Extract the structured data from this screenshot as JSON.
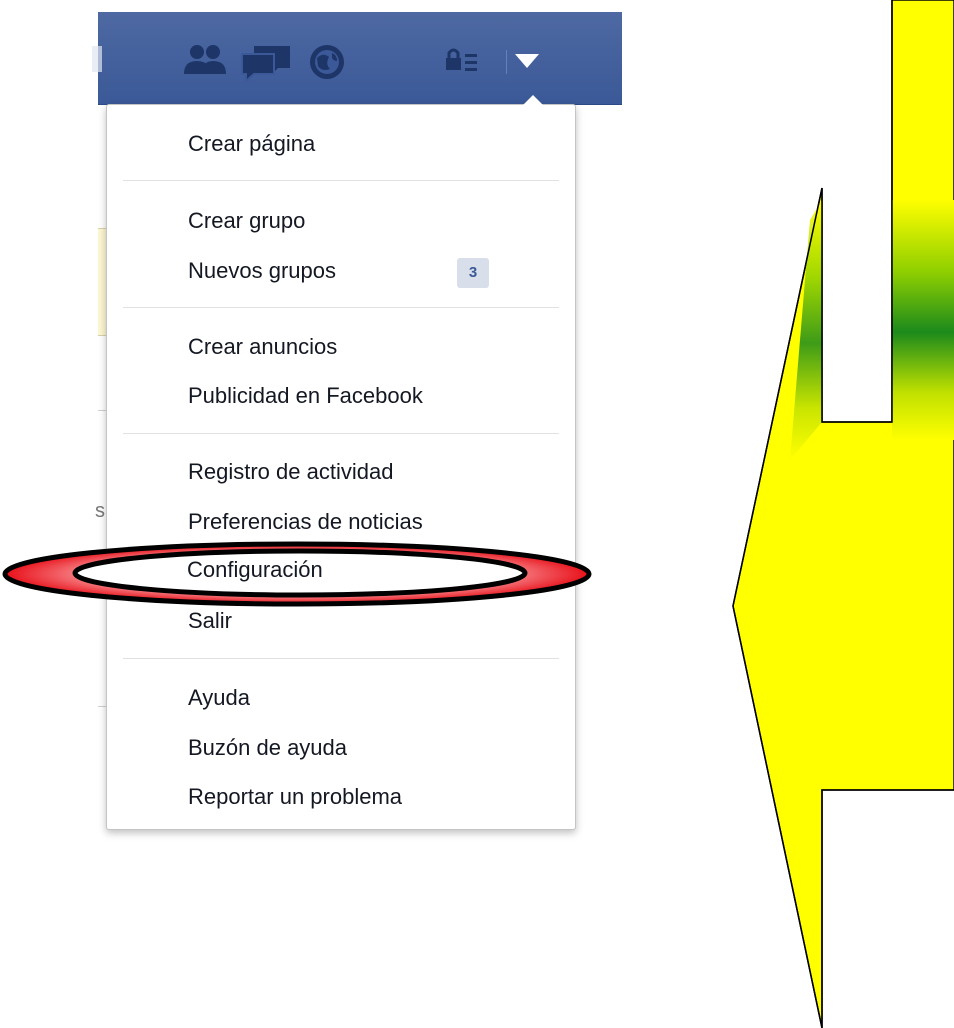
{
  "topbar": {
    "icons": [
      "friends-icon",
      "messages-icon",
      "globe-icon",
      "privacy-icon",
      "account-menu-arrow-icon"
    ]
  },
  "menu": {
    "create_page": "Crear página",
    "create_group": "Crear grupo",
    "new_groups": "Nuevos grupos",
    "new_groups_count": "3",
    "create_ads": "Crear anuncios",
    "advertising": "Publicidad en Facebook",
    "activity_log": "Registro de actividad",
    "news_prefs": "Preferencias de noticias",
    "settings": "Configuración",
    "logout": "Salir",
    "help": "Ayuda",
    "support_inbox": "Buzón de ayuda",
    "report_problem": "Reportar un problema"
  },
  "background": {
    "partial_char": "s"
  },
  "colors": {
    "facebook_blue": "#3b5998",
    "highlight_red": "#e8101a",
    "arrow_yellow": "#ffff00",
    "arrow_green": "#1c8a1c"
  }
}
